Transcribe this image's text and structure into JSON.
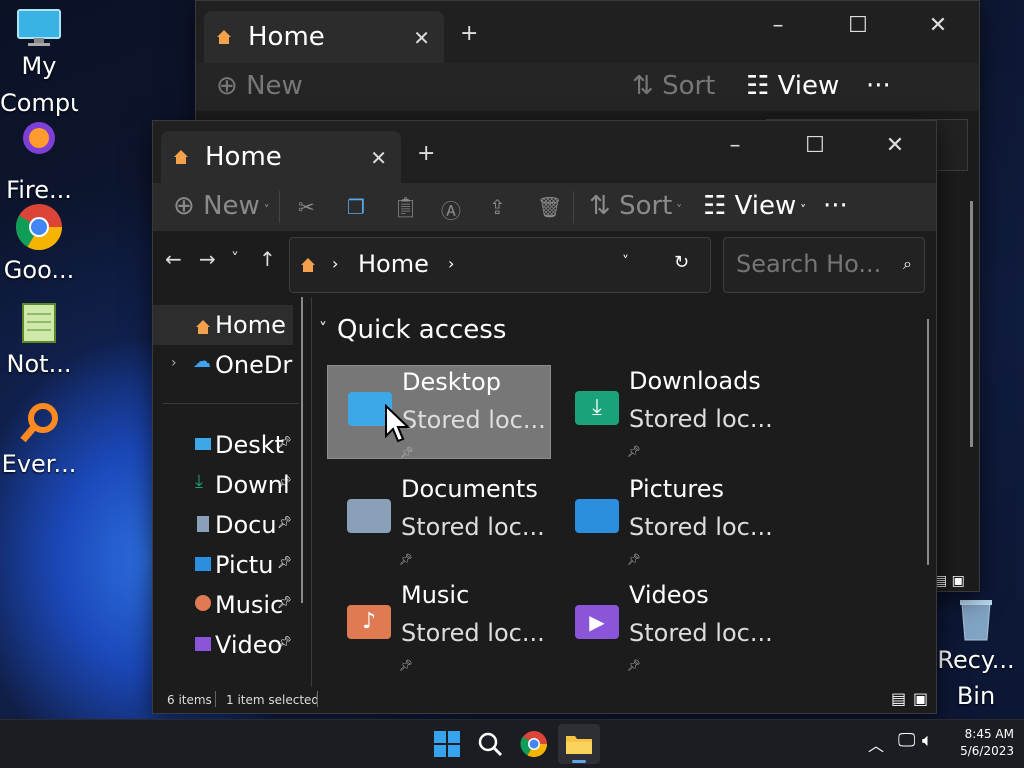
{
  "desktop": {
    "icons": [
      {
        "label": "My Computer"
      },
      {
        "label": "Fire..."
      },
      {
        "label": "Goo..."
      },
      {
        "label": "Not..."
      },
      {
        "label": "Ever..."
      },
      {
        "label": "Recy..."
      },
      {
        "label": "Bin"
      }
    ]
  },
  "back_window": {
    "tab_title": "Home",
    "toolbar": {
      "new": "New",
      "sort": "Sort",
      "view": "View",
      "more": "···"
    }
  },
  "window": {
    "tab_title": "Home",
    "toolbar": {
      "new": "New",
      "sort": "Sort",
      "view": "View",
      "more": "···"
    },
    "address": {
      "crumb": "Home",
      "search_placeholder": "Search Ho..."
    },
    "nav": {
      "items": [
        {
          "label": "Home"
        },
        {
          "label": "OneDr"
        },
        {
          "label": "Deskt"
        },
        {
          "label": "Downl"
        },
        {
          "label": "Docu"
        },
        {
          "label": "Pictu"
        },
        {
          "label": "Music"
        },
        {
          "label": "Video"
        }
      ]
    },
    "section_title": "Quick access",
    "quick_access": [
      {
        "name": "Desktop",
        "sub": "Stored loc...",
        "color": "#3da8e8"
      },
      {
        "name": "Downloads",
        "sub": "Stored loc...",
        "color": "#1aa37a"
      },
      {
        "name": "Documents",
        "sub": "Stored loc...",
        "color": "#8aa0b8"
      },
      {
        "name": "Pictures",
        "sub": "Stored loc...",
        "color": "#2b8fe0"
      },
      {
        "name": "Music",
        "sub": "Stored loc...",
        "color": "#e07a52"
      },
      {
        "name": "Videos",
        "sub": "Stored loc...",
        "color": "#8a55d8"
      }
    ],
    "status": {
      "items": "6 items",
      "selected": "1 item selected"
    }
  },
  "taskbar": {
    "time": "8:45 AM",
    "date": "5/6/2023"
  },
  "colors": {
    "accent": "#0078d4",
    "selection": "#777777"
  }
}
